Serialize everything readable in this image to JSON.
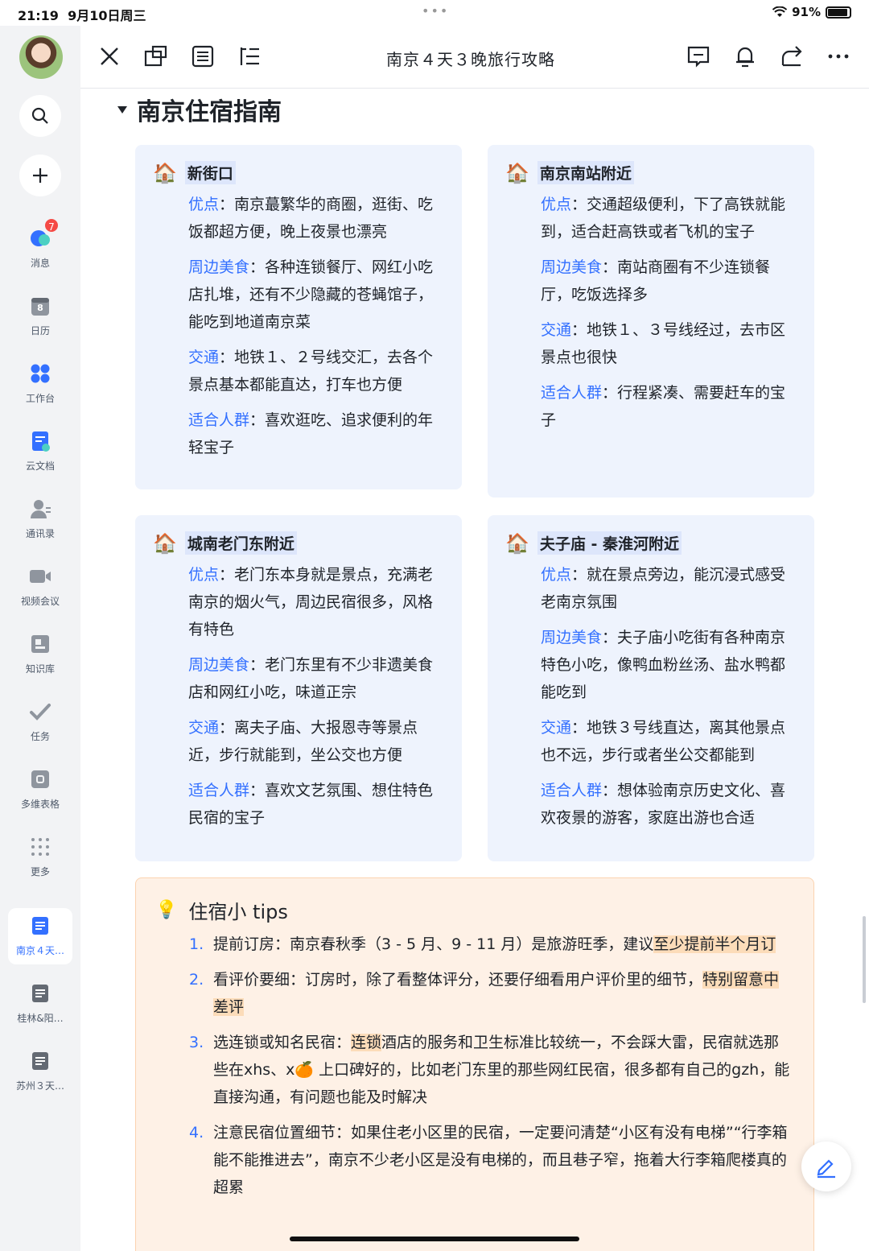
{
  "status": {
    "time": "21:19",
    "date": "9月10日周三",
    "battery": "91%",
    "battery_level": 0.91
  },
  "sidebar": {
    "messages_badge": "7",
    "items": [
      {
        "label": "消息"
      },
      {
        "label": "日历",
        "calendar_day": "8"
      },
      {
        "label": "工作台"
      },
      {
        "label": "云文档"
      },
      {
        "label": "通讯录"
      },
      {
        "label": "视频会议"
      },
      {
        "label": "知识库"
      },
      {
        "label": "任务"
      },
      {
        "label": "多维表格"
      },
      {
        "label": "更多"
      }
    ],
    "docs": [
      {
        "label": "南京４天…",
        "active": true
      },
      {
        "label": "桂林&阳…"
      },
      {
        "label": "苏州３天…"
      }
    ]
  },
  "topbar": {
    "title": "南京４天３晚旅行攻略"
  },
  "section": {
    "title": "南京住宿指南"
  },
  "cards": [
    {
      "title": "新街口",
      "rows": [
        {
          "key": "优点",
          "text": "南京蕞繁华的商圈，逛街、吃饭都超方便，晚上夜景也漂亮"
        },
        {
          "key": "周边美食",
          "text": "各种连锁餐厅、网红小吃店扎堆，还有不少隐藏的苍蝇馆子，能吃到地道南京菜"
        },
        {
          "key": "交通",
          "text": "地铁１、２号线交汇，去各个景点基本都能直达，打车也方便"
        },
        {
          "key": "适合人群",
          "text": "喜欢逛吃、追求便利的年轻宝子"
        }
      ]
    },
    {
      "title": "南京南站附近",
      "rows": [
        {
          "key": "优点",
          "text": "交通超级便利，下了高铁就能到，适合赶高铁或者飞机的宝子"
        },
        {
          "key": "周边美食",
          "text": "南站商圈有不少连锁餐厅，吃饭选择多"
        },
        {
          "key": "交通",
          "text": "地铁１、３号线经过，去市区景点也很快"
        },
        {
          "key": "适合人群",
          "text": "行程紧凑、需要赶车的宝子"
        }
      ]
    },
    {
      "title": "城南老门东附近",
      "rows": [
        {
          "key": "优点",
          "text": "老门东本身就是景点，充满老南京的烟火气，周边民宿很多，风格有特色"
        },
        {
          "key": "周边美食",
          "text": "老门东里有不少非遗美食店和网红小吃，味道正宗"
        },
        {
          "key": "交通",
          "text": "离夫子庙、大报恩寺等景点近，步行就能到，坐公交也方便"
        },
        {
          "key": "适合人群",
          "text": "喜欢文艺氛围、想住特色民宿的宝子"
        }
      ]
    },
    {
      "title": "夫子庙 - 秦淮河附近",
      "rows": [
        {
          "key": "优点",
          "text": "就在景点旁边，能沉浸式感受老南京氛围"
        },
        {
          "key": "周边美食",
          "text": "夫子庙小吃街有各种南京特色小吃，像鸭血粉丝汤、盐水鸭都能吃到"
        },
        {
          "key": "交通",
          "text": "地铁３号线直达，离其他景点也不远，步行或者坐公交都能到"
        },
        {
          "key": "适合人群",
          "text": "想体验南京历史文化、喜欢夜景的游客，家庭出游也合适"
        }
      ]
    }
  ],
  "tips": {
    "title": "住宿小 tips",
    "items": [
      {
        "n": "1.",
        "a": "提前订房：南京春秋季（3 - 5 月、9 - 11 月）是旅游旺季，建议",
        "hl": "至少提前半个月订",
        "b": ""
      },
      {
        "n": "2.",
        "a": "看评价要细：订房时，除了看整体评分，还要仔细看用户评价里的细节，",
        "hl": "特别留意中差评",
        "b": ""
      },
      {
        "n": "3.",
        "a": "选连锁或知名民宿：",
        "hl": "连锁",
        "b": "酒店的服务和卫生标准比较统一，不会踩大雷，民宿就选那些在xhs、x🍊 上口碑好的，比如老门东里的那些网红民宿，很多都有自己的gzh，能直接沟通，有问题也能及时解决"
      },
      {
        "n": "4.",
        "a": "注意民宿位置细节：如果住老小区里的民宿，一定要问清楚“小区有没有电梯”“行李箱能不能推进去”，南京不少老小区是没有电梯的，而且巷子窄，拖着大行李箱爬楼真的超累",
        "hl": "",
        "b": ""
      }
    ]
  }
}
